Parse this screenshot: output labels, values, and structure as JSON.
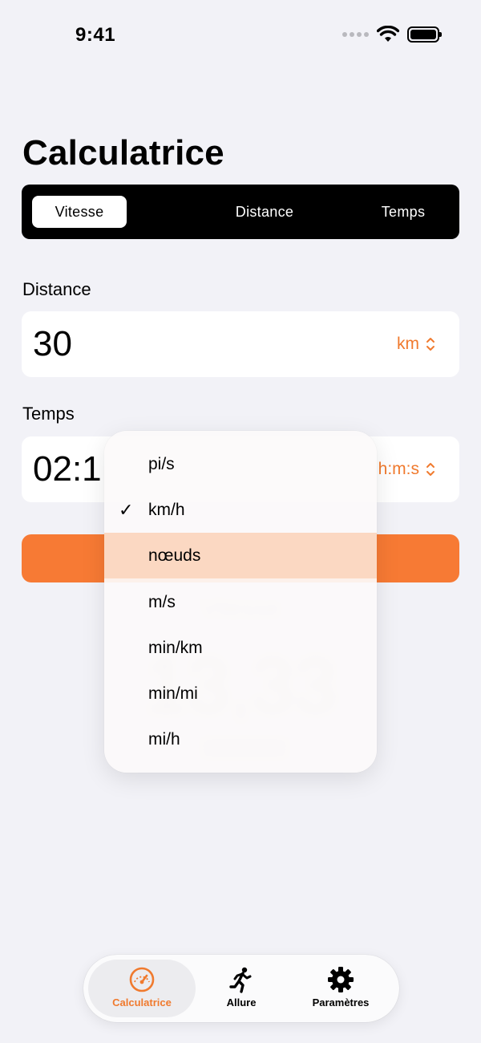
{
  "status": {
    "time": "9:41"
  },
  "title": "Calculatrice",
  "segments": [
    {
      "label": "Vitesse",
      "active": true
    },
    {
      "label": "Distance",
      "active": false
    },
    {
      "label": "Temps",
      "active": false
    }
  ],
  "distance": {
    "label": "Distance",
    "value": "30",
    "unit": "km"
  },
  "temps": {
    "label": "Temps",
    "value": "02:1",
    "unit": "h:m:s"
  },
  "result": {
    "label": "Vitesse",
    "value": "13,33"
  },
  "dropdown": {
    "items": [
      {
        "label": "pi/s"
      },
      {
        "label": "km/h",
        "checked": true
      },
      {
        "label": "nœuds",
        "highlighted": true
      },
      {
        "label": "m/s"
      },
      {
        "label": "min/km"
      },
      {
        "label": "min/mi"
      },
      {
        "label": "mi/h"
      }
    ]
  },
  "tabs": [
    {
      "label": "Calculatrice",
      "icon": "speedometer-icon",
      "active": true
    },
    {
      "label": "Allure",
      "icon": "runner-icon",
      "active": false
    },
    {
      "label": "Paramètres",
      "icon": "gear-icon",
      "active": false
    }
  ],
  "colors": {
    "accent": "#f07a2e",
    "button": "#f77a34",
    "background": "#f2f2f7"
  }
}
